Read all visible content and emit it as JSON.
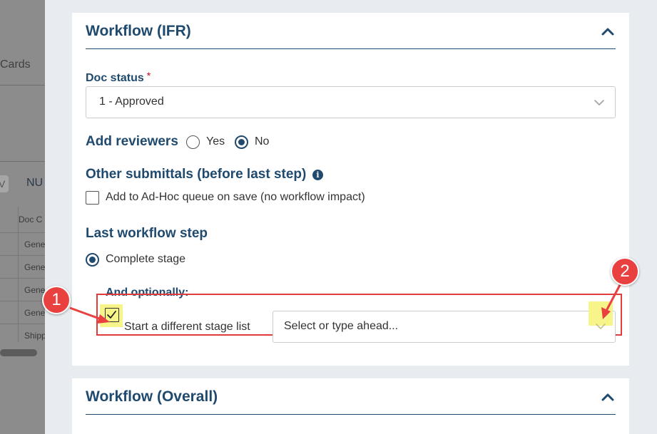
{
  "background": {
    "cards_label": "Cards",
    "pill_label": "V",
    "num_label": "NU",
    "table_header": "Doc C",
    "table_rows": [
      "Gene",
      "Gene",
      "Gene",
      "Gene",
      "Shipp"
    ]
  },
  "workflow_ifr": {
    "title": "Workflow (IFR)",
    "doc_status_label": "Doc status",
    "required_mark": "*",
    "doc_status_value": "1 - Approved",
    "add_reviewers_label": "Add reviewers",
    "reviewer_options": [
      "Yes",
      "No"
    ],
    "reviewer_selected": "No",
    "other_submittals_label": "Other submittals (before last step)",
    "info_glyph": "i",
    "adhoc_label": "Add to Ad-Hoc queue on save (no workflow impact)",
    "adhoc_checked": false,
    "last_step_label": "Last workflow step",
    "complete_stage_label": "Complete stage",
    "complete_stage_selected": true,
    "optionally_label": "And optionally:",
    "stage_list_label": "Start a different stage list",
    "stage_list_checked": true,
    "stage_list_placeholder": "Select or type ahead..."
  },
  "workflow_overall": {
    "title": "Workflow (Overall)"
  },
  "annotations": {
    "callout_1": "1",
    "callout_2": "2"
  },
  "colors": {
    "accent": "#1f4a6e",
    "annotation_red": "#e8413f",
    "highlight_yellow": "#f7f58a",
    "required_red": "#d0021b"
  },
  "icons": {
    "collapse": "chevron-up-icon",
    "dropdown": "chevron-down-icon",
    "info": "info-icon",
    "check": "checkmark-icon"
  }
}
